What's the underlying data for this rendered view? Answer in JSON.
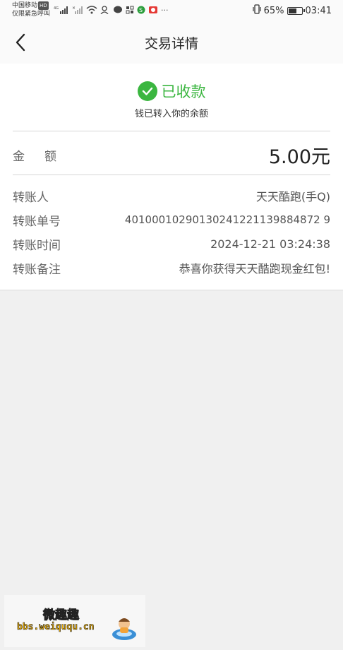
{
  "status_bar": {
    "carrier_line1": "中国移动",
    "carrier_badge": "HD",
    "carrier_line2": "仅限紧急呼叫",
    "battery_percent": "65%",
    "battery_level": 0.65,
    "time": "03:41",
    "overflow": "···"
  },
  "header": {
    "title": "交易详情"
  },
  "status": {
    "text": "已收款",
    "subtext": "钱已转入你的余额",
    "color": "#3bb640"
  },
  "amount": {
    "label": "金额",
    "value": "5.00元"
  },
  "details": [
    {
      "label": "转账人",
      "value": "天天酷跑(手Q)"
    },
    {
      "label": "转账单号",
      "value": "40100010290130241221139884872 9"
    },
    {
      "label": "转账时间",
      "value": "2024-12-21 03:24:38"
    },
    {
      "label": "转账备注",
      "value": "恭喜你获得天天酷跑现金红包!"
    }
  ],
  "watermark": {
    "title": "微趣趣",
    "url": "bbs.weiququ.cn"
  }
}
